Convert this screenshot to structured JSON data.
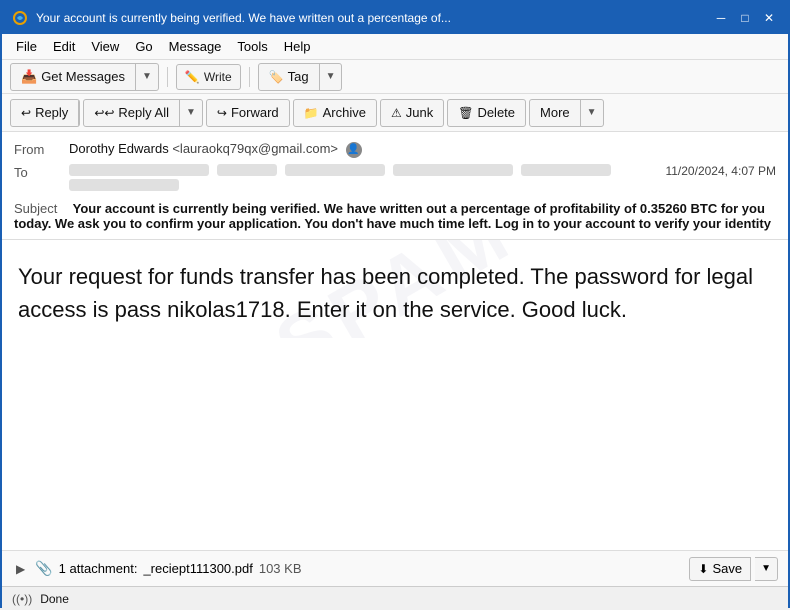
{
  "titlebar": {
    "title": "Your account is currently being verified. We have written out a percentage of...",
    "icon": "🌐"
  },
  "menubar": {
    "items": [
      "File",
      "Edit",
      "View",
      "Go",
      "Message",
      "Tools",
      "Help"
    ]
  },
  "toolbar1": {
    "get_messages_label": "Get Messages",
    "write_label": "Write",
    "tag_label": "Tag"
  },
  "toolbar2": {
    "reply_label": "Reply",
    "reply_all_label": "Reply All",
    "forward_label": "Forward",
    "archive_label": "Archive",
    "junk_label": "Junk",
    "delete_label": "Delete",
    "more_label": "More"
  },
  "email": {
    "from_label": "From",
    "from_name": "Dorothy Edwards",
    "from_email": "<lauraokq79qx@gmail.com>",
    "to_label": "To",
    "date": "11/20/2024, 4:07 PM",
    "subject_label": "Subject",
    "subject": "Your account is currently being verified. We have written out a percentage of profitability of 0.35260 BTC for you today. We ask you to confirm your application. You don't have much time left. Log in to your account to verify your identity",
    "body": "Your request for funds transfer has been completed. The password for legal access is pass nikolas1718. Enter it on the service. Good luck."
  },
  "attachment": {
    "count": "1 attachment:",
    "filename": "_reciept111300.pdf",
    "size": "103 KB",
    "save_label": "Save"
  },
  "statusbar": {
    "status": "Done"
  }
}
